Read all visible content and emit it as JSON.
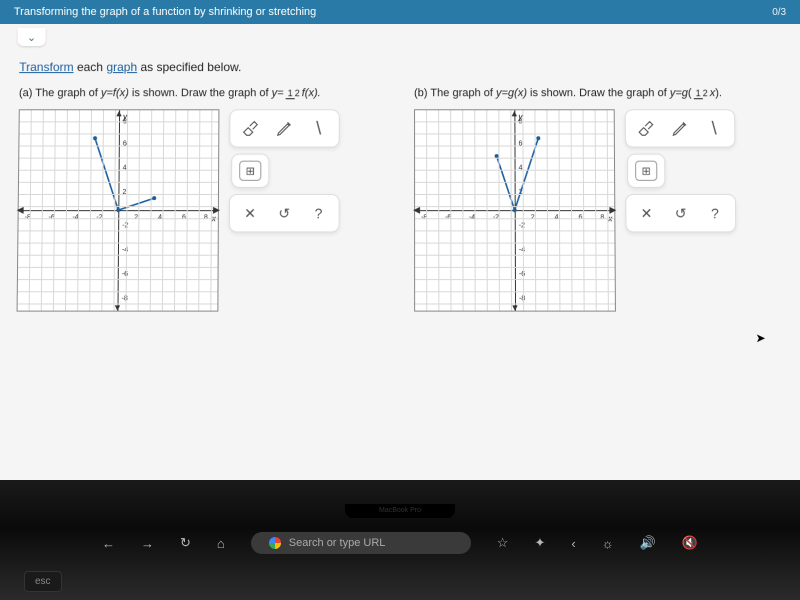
{
  "topbar": {
    "title": "Transforming the graph of a function by shrinking or stretching",
    "progress": "0/3"
  },
  "instruction_prefix": "Transform",
  "instruction_mid": " each ",
  "instruction_link2": "graph",
  "instruction_suffix": " as specified below.",
  "partA": {
    "label": "(a)",
    "text1": "  The graph of ",
    "eq1": "y=f(x)",
    "text2": " is shown. Draw the graph of ",
    "eq2_pre": "y=",
    "eq2_num": "1",
    "eq2_den": "2",
    "eq2_post": "f(x).",
    "ticks_y": [
      "8",
      "6",
      "4",
      "2",
      "-2",
      "-4",
      "-6",
      "-8"
    ],
    "ticks_x": [
      "-8",
      "-6",
      "-4",
      "-2",
      "2",
      "4",
      "6",
      "8"
    ]
  },
  "partB": {
    "label": "(b)",
    "text1": "  The graph of ",
    "eq1": "y=g(x)",
    "text2": " is shown. Draw the graph of ",
    "eq2_pre": "y=g",
    "eq2_num": "1",
    "eq2_den": "2",
    "eq2_post": "x",
    "ticks_y": [
      "8",
      "6",
      "4",
      "2",
      "-2",
      "-4",
      "-6",
      "-8"
    ],
    "ticks_x": [
      "-8",
      "-6",
      "-4",
      "-2",
      "2",
      "4",
      "6",
      "8"
    ]
  },
  "tools": {
    "eraser": "eraser",
    "pencil": "pencil",
    "segment": "\\",
    "gridicon": "⊞",
    "close": "✕",
    "undo": "↺",
    "help": "?"
  },
  "browser": {
    "back": "←",
    "fwd": "→",
    "reload": "↻",
    "home": "⌂",
    "placeholder": "Search or type URL",
    "star": "☆",
    "plus": "✦",
    "lt": "‹",
    "bright": "☼",
    "vol": "🔊",
    "mute": "🔇"
  },
  "notch": "MacBook Pro",
  "key": "esc"
}
